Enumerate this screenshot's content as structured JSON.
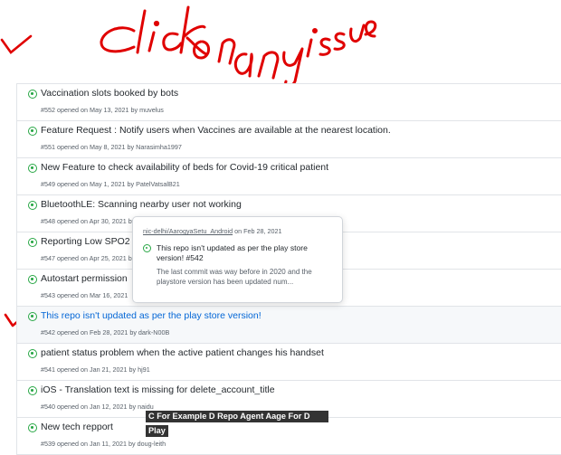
{
  "annotation": {
    "handwritten_text": "Click on any issue",
    "ink_color": "#e00000"
  },
  "issues": [
    {
      "title": "Vaccination slots booked by bots",
      "number": "#552",
      "opened": "opened on May 13, 2021 by",
      "author": "muvelus"
    },
    {
      "title": "Feature Request : Notify users when Vaccines are available at the nearest location.",
      "number": "#551",
      "opened": "opened on May 8, 2021 by",
      "author": "Narasimha1997"
    },
    {
      "title": "New Feature to check availability of beds for Covid-19 critical patient",
      "number": "#549",
      "opened": "opened on May 1, 2021 by",
      "author": "PatelVatsalB21"
    },
    {
      "title": "BluetoothLE: Scanning nearby user not working",
      "number": "#548",
      "opened": "opened on Apr 30, 2021 by",
      "author": ""
    },
    {
      "title": "Reporting Low SPO2 i",
      "number": "#547",
      "opened": "opened on Apr 25, 2021 b",
      "author": ""
    },
    {
      "title": "Autostart permission",
      "number": "#543",
      "opened": "opened on Mar 16, 2021",
      "author": ""
    },
    {
      "title": "This repo isn't updated as per the play store version!",
      "number": "#542",
      "opened": "opened on Feb 28, 2021 by",
      "author": "dark-N00B"
    },
    {
      "title": "patient status problem when the active patient changes his handset",
      "number": "#541",
      "opened": "opened on Jan 21, 2021 by",
      "author": "hj91"
    },
    {
      "title": "iOS - Translation text is missing for delete_account_title",
      "number": "#540",
      "opened": "opened on Jan 12, 2021 by",
      "author": "naidu"
    },
    {
      "title": "New tech repport",
      "number": "#539",
      "opened": "opened on Jan 11, 2021 by",
      "author": "doug-leith"
    }
  ],
  "popover": {
    "repo": "nic-delhi/AarogyaSetu_Android",
    "date": "on Feb 28, 2021",
    "title": "This repo isn't updated as per the play store version! #542",
    "body": "The last commit was way before in 2020 and the playstore version has been updated num..."
  },
  "captions": {
    "line1": "C For Example D Repo Agent Aage For D",
    "line2": "Play"
  },
  "colors": {
    "open_icon": "#28a745",
    "link_blue": "#0366d6",
    "caption_bg": "#333333"
  }
}
